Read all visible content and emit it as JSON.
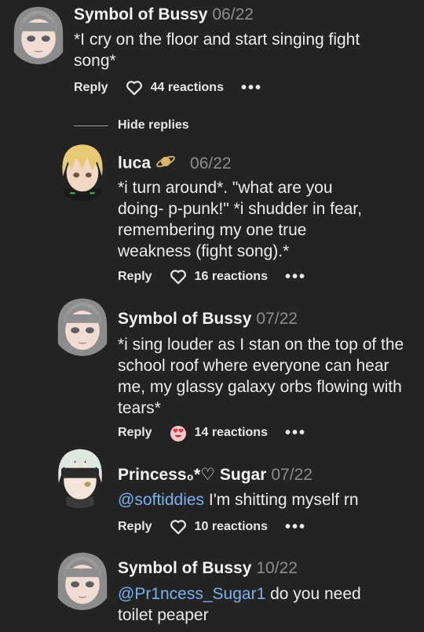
{
  "comments": [
    {
      "author": "Symbol of Bussy",
      "date": "06/22",
      "body": "*I cry on the floor and start singing fight song*",
      "reply_label": "Reply",
      "reactions": "44 reactions",
      "more": "•••",
      "reaction_icon": "heart-outline-icon",
      "avatar": "gray-haired-girl-avatar"
    },
    {
      "author": "luca",
      "date": "06/22",
      "badge": "saturn-icon",
      "body": "*i turn around*. \"what are you doing- p-punk!\" *i shudder in fear, remembering my one true weakness (fight song).*",
      "reply_label": "Reply",
      "reactions": "16 reactions",
      "more": "•••",
      "reaction_icon": "heart-outline-icon",
      "avatar": "blonde-boy-avatar"
    },
    {
      "author": "Symbol of Bussy",
      "date": "07/22",
      "body": "*i sing louder as I stan on the top of the school roof where everyone can hear me, my glassy galaxy orbs flowing with tears*",
      "reply_label": "Reply",
      "reactions": "14 reactions",
      "more": "•••",
      "reaction_icon": "heart-eyes-emoji-icon",
      "avatar": "gray-haired-girl-avatar"
    },
    {
      "author": "Princess₀*♡ Sugar",
      "date": "07/22",
      "mention": "@softiddies",
      "body": " I'm shitting myself rn",
      "reply_label": "Reply",
      "reactions": "10 reactions",
      "more": "•••",
      "reaction_icon": "heart-outline-icon",
      "avatar": "white-haired-blindfold-avatar"
    },
    {
      "author": "Symbol of Bussy",
      "date": "10/22",
      "mention": "@Pr1ncess_Sugar1",
      "body": " do you need toilet peaper",
      "avatar": "gray-haired-girl-avatar"
    }
  ],
  "hide_replies": "Hide replies",
  "colors": {
    "background": "#232323",
    "text": "#ececec",
    "muted": "#8d8d8d",
    "mention": "#7ab2f0"
  }
}
